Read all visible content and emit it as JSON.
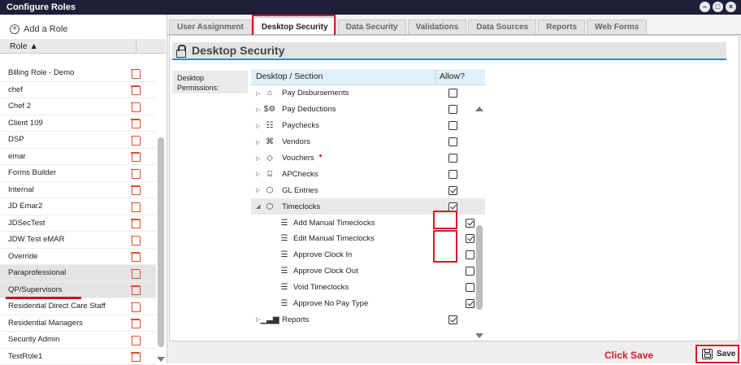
{
  "window": {
    "title": "Configure Roles"
  },
  "left": {
    "add_role_label": "Add a Role",
    "column_header": "Role ▲",
    "roles": [
      "Billing Role - Demo",
      "chef",
      "Chef 2",
      "Client 109",
      "DSP",
      "emar",
      "Forms Builder",
      "Internal",
      "JD Emar2",
      "JDSecTest",
      "JDW Test eMAR",
      "Override",
      "Paraprofessional",
      "QP/Supervisors",
      "Residential Direct Care Staff",
      "Residential Managers",
      "Security Admin",
      "TestRole1"
    ],
    "selected_role": "QP/Supervisors"
  },
  "tabs": [
    "User Assignment",
    "Desktop Security",
    "Data Security",
    "Validations",
    "Data Sources",
    "Reports",
    "Web Forms"
  ],
  "active_tab": "Desktop Security",
  "section": {
    "title": "Desktop Security",
    "permissions_label": "Desktop Permissions:",
    "col_section": "Desktop / Section",
    "col_allow": "Allow?"
  },
  "rows": [
    {
      "label": "Pay Disbursements",
      "level": 0,
      "icon": "dollar-house-icon",
      "allow": false
    },
    {
      "label": "Pay Deductions",
      "level": 0,
      "icon": "dollar-gear-icon",
      "allow": false
    },
    {
      "label": "Paychecks",
      "level": 0,
      "icon": "paycheck-icon",
      "allow": false
    },
    {
      "label": "Vendors",
      "level": 0,
      "icon": "vendor-icon",
      "allow": false
    },
    {
      "label": "Vouchers",
      "level": 0,
      "icon": "tag-icon",
      "allow": false
    },
    {
      "label": "APChecks",
      "level": 0,
      "icon": "document-gear-icon",
      "allow": false
    },
    {
      "label": "GL Entries",
      "level": 0,
      "icon": "hexagon-icon",
      "allow": true
    },
    {
      "label": "Timeclocks",
      "level": 0,
      "icon": "hexagon-icon",
      "allow": true,
      "expanded": true
    },
    {
      "label": "Add Manual Timeclocks",
      "level": 1,
      "icon": "list-icon",
      "allow": true
    },
    {
      "label": "Edit Manual Timeclocks",
      "level": 1,
      "icon": "list-icon",
      "allow": true
    },
    {
      "label": "Approve Clock In",
      "level": 1,
      "icon": "list-icon",
      "allow": false
    },
    {
      "label": "Approve Clock Out",
      "level": 1,
      "icon": "list-icon",
      "allow": false
    },
    {
      "label": "Void Timeclocks",
      "level": 1,
      "icon": "list-icon",
      "allow": false
    },
    {
      "label": "Approve No Pay Type",
      "level": 1,
      "icon": "list-icon",
      "allow": true
    },
    {
      "label": "Reports",
      "level": 0,
      "icon": "bar-chart-icon",
      "allow": true
    }
  ],
  "footer": {
    "annotation": "Click Save",
    "save_label": "Save"
  }
}
